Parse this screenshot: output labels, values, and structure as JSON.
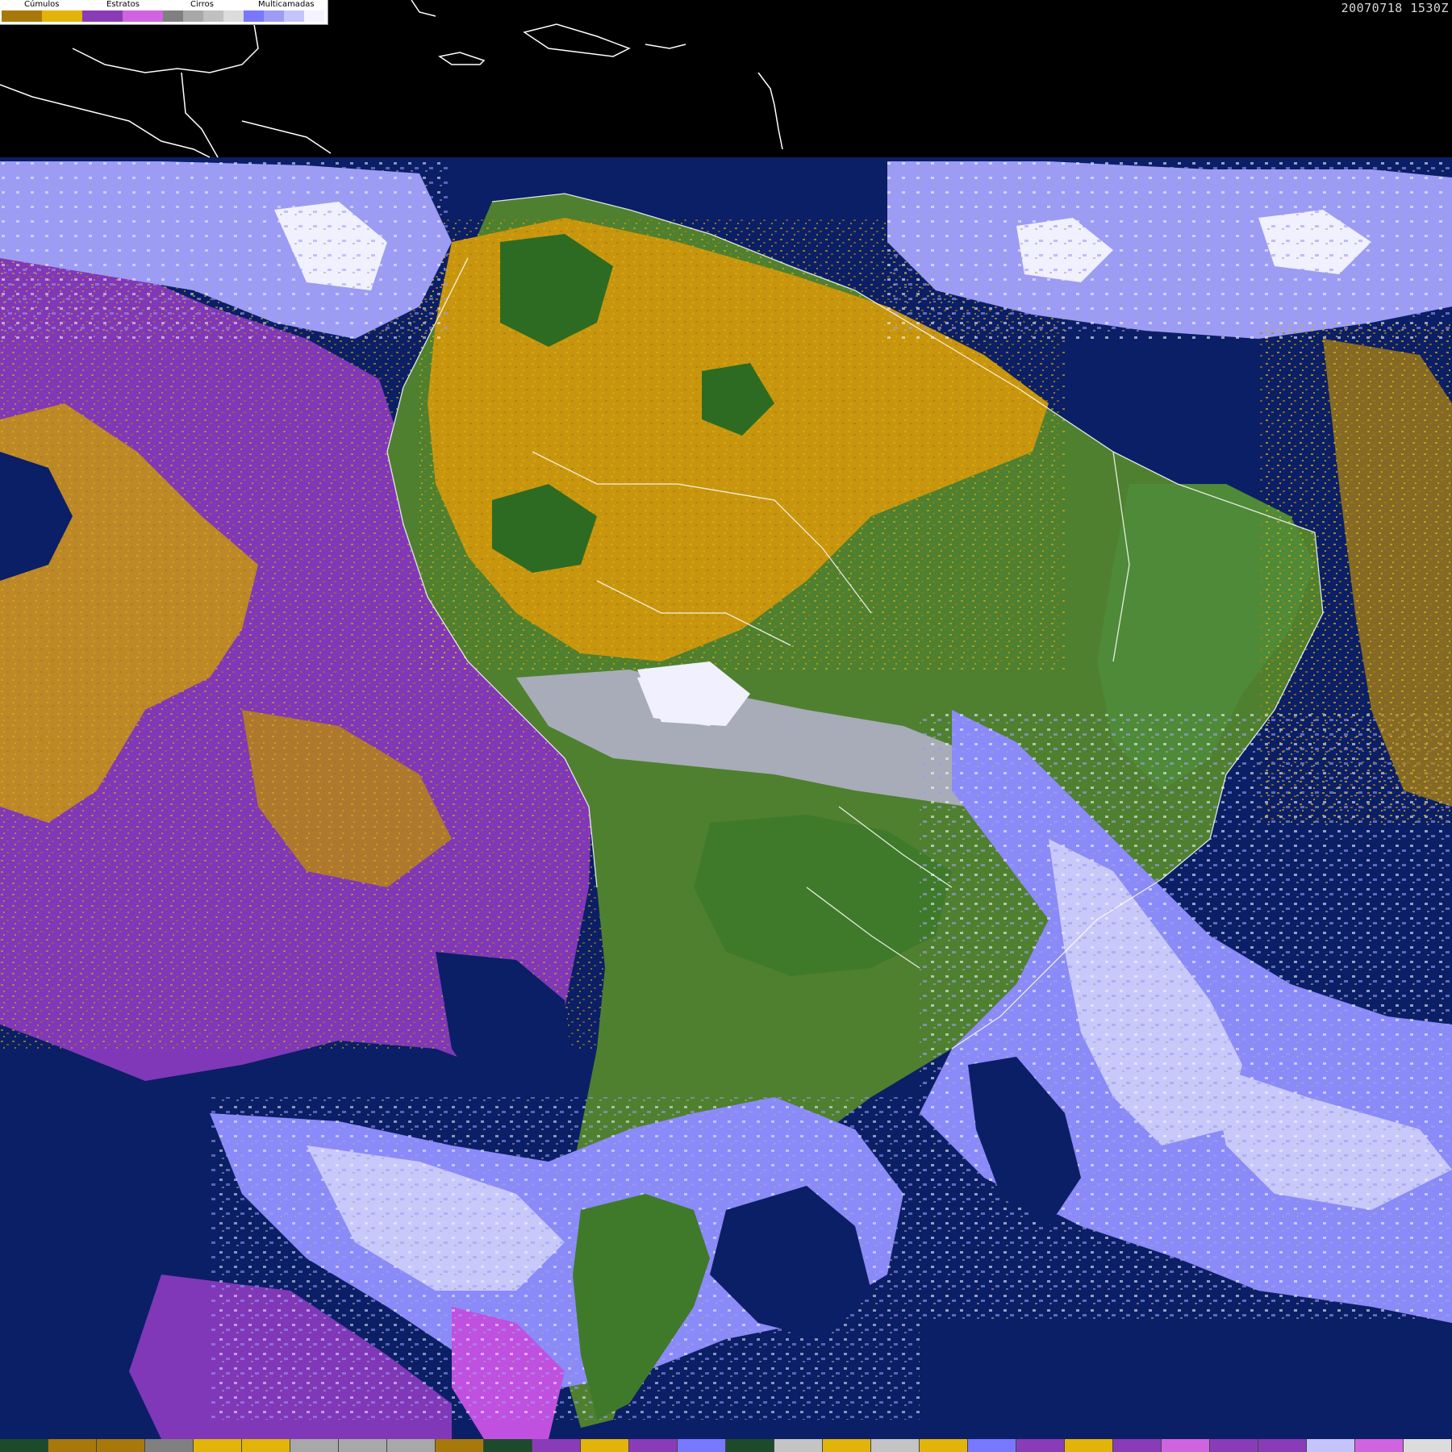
{
  "header": {
    "timestamp": "20070718 1530Z"
  },
  "legend": {
    "groups": [
      {
        "label": "Cúmulos",
        "colors": [
          "#a8790a",
          "#e2b40a"
        ]
      },
      {
        "label": "Estratos",
        "colors": [
          "#8a3cb8",
          "#d064e0"
        ]
      },
      {
        "label": "Cirros",
        "colors": [
          "#808080",
          "#a8a8a8",
          "#c0c0c0",
          "#dcdcdc"
        ]
      },
      {
        "label": "Multicamadas",
        "colors": [
          "#7878ff",
          "#9c9cf4",
          "#c4c4fa",
          "#f4f4ff"
        ]
      }
    ]
  },
  "map": {
    "colors": {
      "ocean": "#0b1f66",
      "land_dark": "#2e6b22",
      "land_light": "#5a8a3c",
      "cumulus_dark": "#a8790a",
      "cumulus_light": "#d8a810",
      "stratus": "#8038b8",
      "stratus_light": "#c050e0",
      "cirrus": "#a8a8b8",
      "multi": "#7878ff",
      "multi_light": "#c8c8fa",
      "white_cloud": "#f0f0ff",
      "coastline": "#ffffff"
    },
    "regions": [
      "South America",
      "Caribbean",
      "Central America",
      "Pacific Ocean",
      "Atlantic Ocean"
    ]
  },
  "bottom_bar": {
    "colors": [
      "#1c4a2a",
      "#a8790a",
      "#a8790a",
      "#808080",
      "#e2b40a",
      "#e2b40a",
      "#a8a8a8",
      "#a8a8a8",
      "#a8a8a8",
      "#a8790a",
      "#1c4a2a",
      "#8a3cb8",
      "#e2b40a",
      "#8a3cb8",
      "#7878ff",
      "#1c4a2a",
      "#c4c4c4",
      "#e2b40a",
      "#c4c4c4",
      "#e2b40a",
      "#7878ff",
      "#8a3cb8",
      "#e2b40a",
      "#8a3cb8",
      "#d064e0",
      "#8a3cb8",
      "#8a3cb8",
      "#c4c4fa",
      "#d064e0",
      "#dcdcdc"
    ]
  }
}
